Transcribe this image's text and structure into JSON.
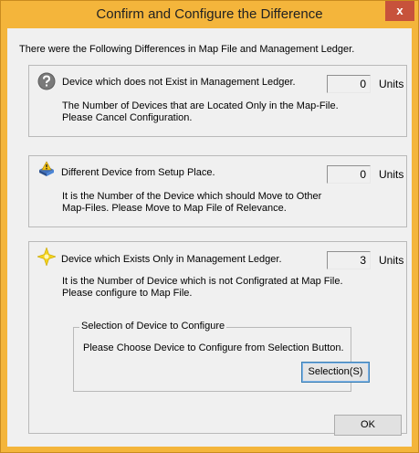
{
  "window": {
    "title": "Confirm and Configure the Difference",
    "close_glyph": "x"
  },
  "intro": "There were the Following Differences in Map File and Management Ledger.",
  "sections": [
    {
      "icon": "question-icon",
      "label": "Device which does not Exist in Management Ledger.",
      "count": "0",
      "units": "Units",
      "desc_line1": "The Number of Devices that are Located Only in the Map-File.",
      "desc_line2": "Please Cancel Configuration."
    },
    {
      "icon": "move-warning-icon",
      "label": "Different Device from Setup Place.",
      "count": "0",
      "units": "Units",
      "desc_line1": "It is the Number of the Device which should Move to Other",
      "desc_line2": "Map-Files. Please Move to Map File of Relevance."
    },
    {
      "icon": "sparkle-icon",
      "label": "Device which Exists Only in Management Ledger.",
      "count": "3",
      "units": "Units",
      "desc_line1": "It is the Number of Device which is not Configrated at Map File.",
      "desc_line2": "Please configure to Map File."
    }
  ],
  "selection_group": {
    "title": "Selection of Device to Configure",
    "desc": "Please Choose Device to Configure from Selection Button.",
    "button_label": "Selection(S)"
  },
  "ok_label": "OK"
}
